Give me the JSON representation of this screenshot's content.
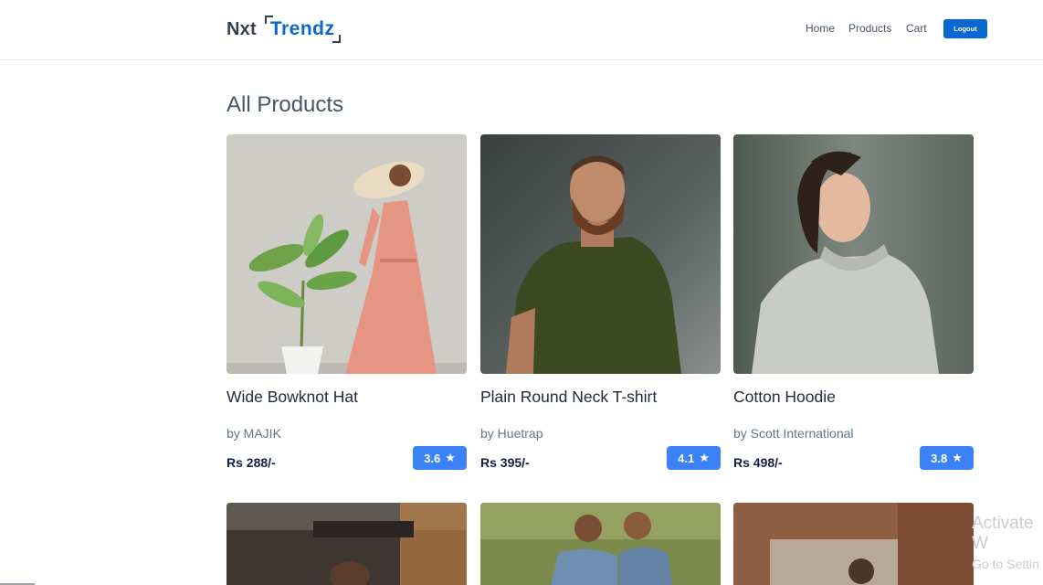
{
  "header": {
    "logo_part1": "Nxt",
    "logo_part2": "Trendz",
    "nav": [
      "Home",
      "Products",
      "Cart"
    ],
    "logout_label": "Logout"
  },
  "colors": {
    "brand_blue": "#0967d2",
    "rating_bg": "#3b82f6",
    "heading": "#475569"
  },
  "page_title": "All Products",
  "products": [
    {
      "title": "Wide Bowknot Hat",
      "brand": "by MAJIK",
      "price": "Rs 288/-",
      "rating": "3.6",
      "image": "woman-sunhat-pink-dress-photo"
    },
    {
      "title": "Plain Round Neck T-shirt",
      "brand": "by Huetrap",
      "price": "Rs 395/-",
      "rating": "4.1",
      "image": "bearded-man-green-tshirt-photo"
    },
    {
      "title": "Cotton Hoodie",
      "brand": "by Scott International",
      "price": "Rs 498/-",
      "rating": "3.8",
      "image": "man-grey-hoodie-photo"
    }
  ],
  "more_products_images": [
    "street-scene-photo",
    "two-men-denim-jackets-photo",
    "woman-brick-arch-photo"
  ],
  "watermark": {
    "line1": "Activate W",
    "line2": "Go to Settin"
  }
}
